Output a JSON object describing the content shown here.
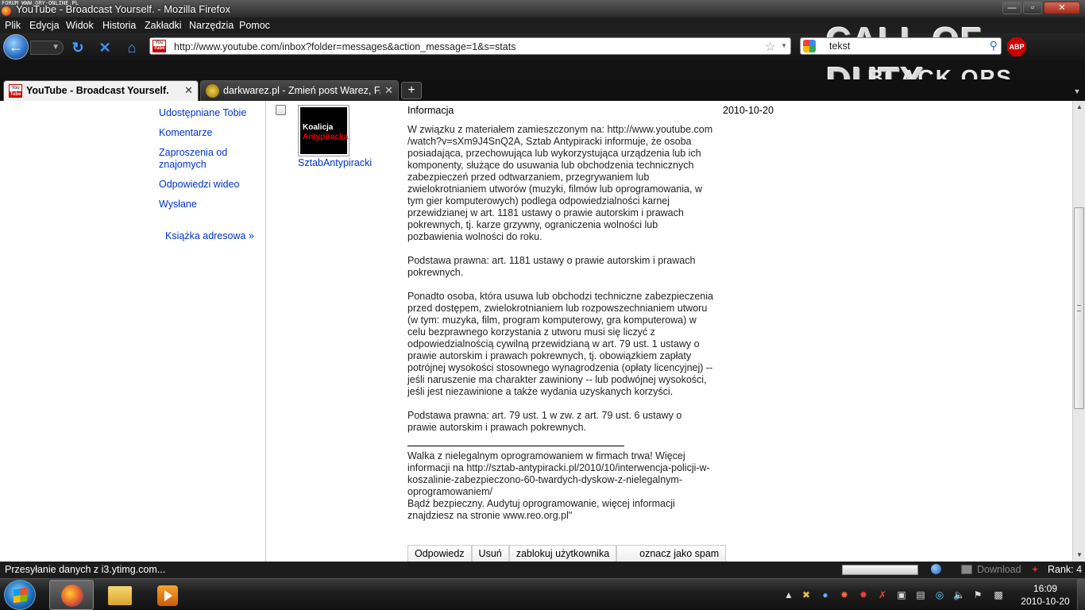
{
  "window": {
    "watermark": "FORUM WWW.GRY-ONLINE.PL",
    "title": "YouTube - Broadcast Yourself. - Mozilla Firefox",
    "min_glyph": "—",
    "max_glyph": "▫",
    "close_glyph": "✕"
  },
  "menu": [
    "Plik",
    "Edycja",
    "Widok",
    "Historia",
    "Zakładki",
    "Narzędzia",
    "Pomoc"
  ],
  "background_logo": {
    "line1": "CALL OF DUTY",
    "line2": "BLACK OPS"
  },
  "navbar": {
    "url": "http://www.youtube.com/inbox?folder=messages&action_message=1&s=stats",
    "search_value": "tekst",
    "abp_label": "ABP"
  },
  "tabs": [
    {
      "label": "YouTube - Broadcast Yourself.",
      "active": true
    },
    {
      "label": "darkwarez.pl - Zmień post Warez, F...",
      "active": false
    }
  ],
  "newtab_label": "+",
  "sidebar": {
    "items": [
      {
        "label": "Udostępniane Tobie"
      },
      {
        "label": "Komentarze"
      },
      {
        "label": "Zaproszenia od znajomych"
      },
      {
        "label": "Odpowiedzi wideo"
      },
      {
        "label": "Wysłane"
      }
    ],
    "address_book": "Książka adresowa »"
  },
  "message": {
    "sender": "SztabAntypiracki",
    "avatar_line1": "Koalicja",
    "avatar_line2": "Antypiracka",
    "subject": "Informacja",
    "date": "2010-10-20",
    "paragraphs": [
      "W związku z materiałem zamieszczonym na: http://www.youtube.com /watch?v=sXm9J4SnQ2A, Sztab Antypiracki informuje, że osoba posiadająca, przechowująca lub wykorzystująca urządzenia lub ich komponenty, służące do usuwania lub obchodzenia technicznych zabezpieczeń przed odtwarzaniem, przegrywaniem lub zwielokrotnianiem utworów (muzyki, filmów lub oprogramowania, w tym gier komputerowych) podlega odpowiedzialności karnej przewidzianej w art. 1181 ustawy o prawie autorskim i prawach pokrewnych, tj. karze grzywny, ograniczenia wolności lub pozbawienia wolności do roku.",
      "Podstawa prawna: art. 1181 ustawy o prawie autorskim i prawach pokrewnych.",
      "Ponadto osoba, która usuwa lub obchodzi techniczne zabezpieczenia przed dostępem, zwielokrotnianiem lub rozpowszechnianiem utworu (w tym: muzyka, film, program komputerowy, gra komputerowa) w celu bezprawnego korzystania z utworu musi się liczyć z odpowiedzialnością cywilną przewidzianą w art. 79 ust. 1 ustawy o prawie autorskim i prawach pokrewnych, tj. obowiązkiem zapłaty potrójnej wysokości stosownego wynagrodzenia (opłaty licencyjnej) -- jeśli naruszenie ma charakter zawiniony -- lub podwójnej wysokości, jeśli jest niezawinione a także wydania uzyskanych korzyści.",
      "Podstawa prawna: art. 79 ust. 1 w zw. z art. 79 ust. 6 ustawy o prawie autorskim i prawach pokrewnych."
    ],
    "signature_1": "Walka z nielegalnym oprogramowaniem w firmach trwa! Więcej informacji na http://sztab-antypiracki.pl/2010/10/interwencja-policji-w-koszalinie-zabezpieczono-60-twardych-dyskow-z-nielegalnym-oprogramowaniem/",
    "signature_2": "Bądź bezpieczny. Audytuj oprogramowanie, więcej informacji znajdziesz na stronie www.reo.org.pl\"",
    "actions": {
      "reply": "Odpowiedz",
      "delete": "Usuń",
      "block": "zablokuj użytkownika",
      "spam": "oznacz jako spam"
    }
  },
  "statusbar": {
    "text": "Przesyłanie danych z i3.ytimg.com...",
    "download": "Download",
    "rank": "Rank: 4"
  },
  "taskbar": {
    "time": "16:09",
    "date": "2010-10-20"
  }
}
